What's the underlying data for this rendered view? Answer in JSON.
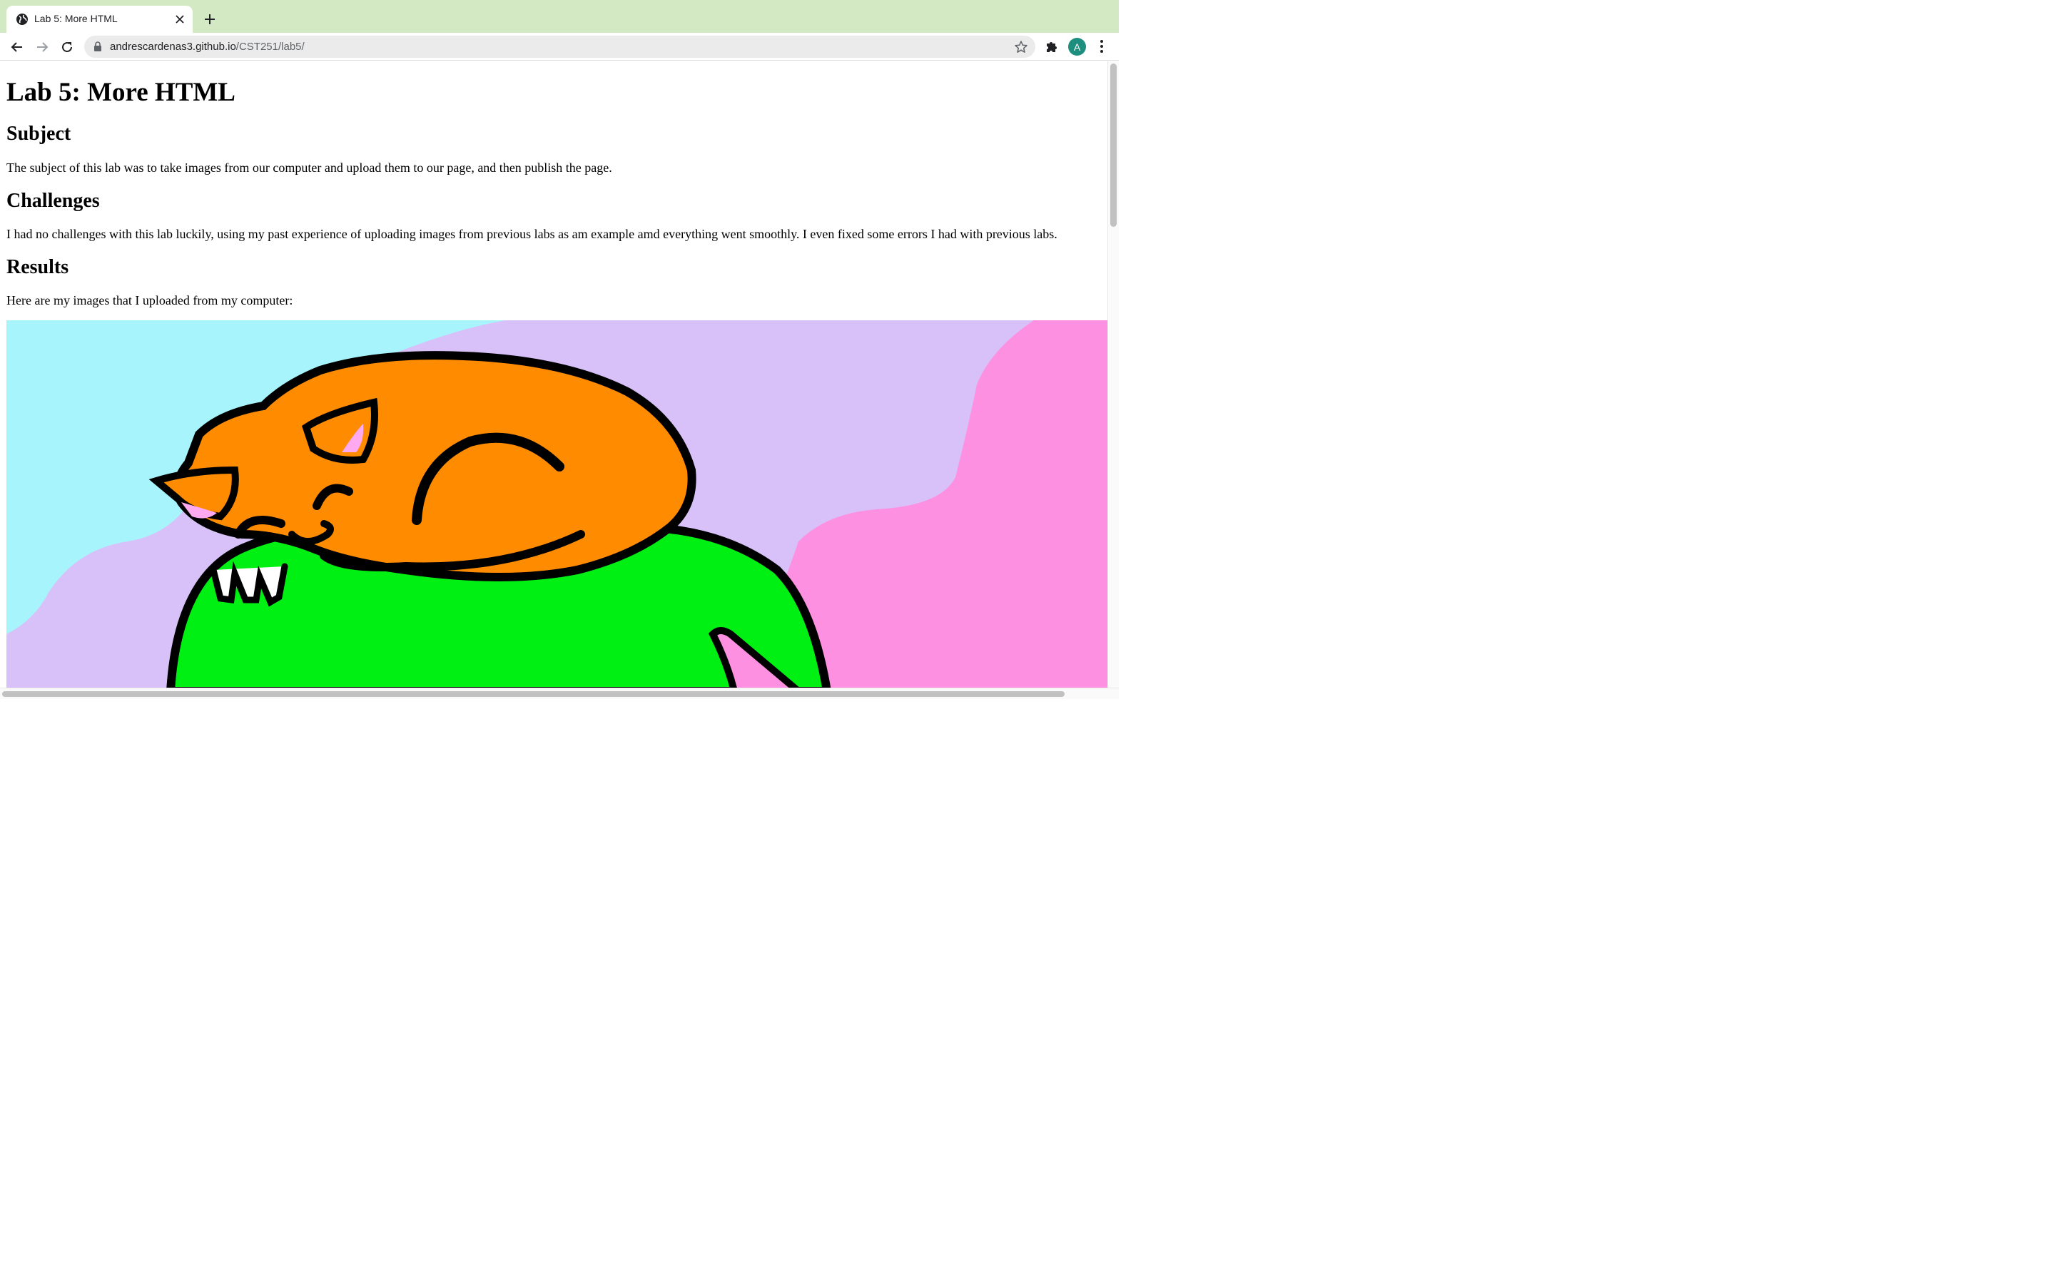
{
  "browser": {
    "tab_title": "Lab 5: More HTML",
    "url_host": "andrescardenas3.github.io",
    "url_path": "/CST251/lab5/",
    "avatar_letter": "A",
    "icons": {
      "favicon": "globe-icon",
      "tab_close": "close-icon",
      "new_tab": "plus-icon",
      "back": "back-arrow-icon",
      "forward": "forward-arrow-icon",
      "reload": "reload-icon",
      "lock": "lock-icon",
      "bookmark": "star-icon",
      "extensions": "puzzle-icon",
      "menu": "kebab-menu-icon"
    },
    "colors": {
      "tabstrip": "#d3e9c4",
      "avatar": "#1e8e7e"
    }
  },
  "page": {
    "title": "Lab 5: More HTML",
    "subject_heading": "Subject",
    "subject_text": "The subject of this lab was to take images from our computer and upload them to our page, and then publish the page.",
    "challenges_heading": "Challenges",
    "challenges_text": "I had no challenges with this lab luckily, using my past experience of uploading images from previous labs as am example amd everything went smoothly. I even fixed some errors I had with previous labs.",
    "results_heading": "Results",
    "results_text": "Here are my images that I uploaded from my computer:",
    "image_colors": {
      "sky": "#a8f4fd",
      "lavender": "#d8c1f8",
      "pink": "#fd90e0",
      "cat": "#ff8c00",
      "body": "#00f014",
      "ear": "#ffaaf0",
      "outline": "#000000"
    }
  }
}
